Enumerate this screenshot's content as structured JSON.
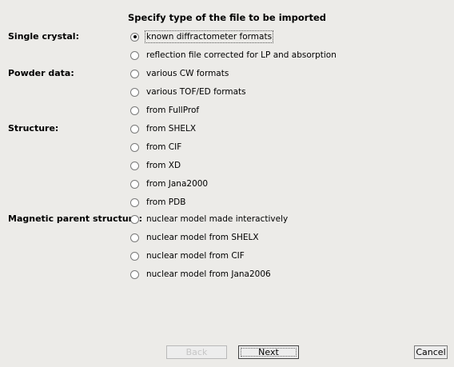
{
  "title": "Specify type of the file to be imported",
  "groups": [
    {
      "label": "Single crystal:",
      "options": [
        {
          "label": "known diffractometer formats",
          "checked": true
        },
        {
          "label": "reflection file corrected for LP and absorption",
          "checked": false
        }
      ]
    },
    {
      "label": "Powder data:",
      "options": [
        {
          "label": "various CW formats",
          "checked": false
        },
        {
          "label": "various TOF/ED formats",
          "checked": false
        },
        {
          "label": "from FullProf",
          "checked": false
        }
      ]
    },
    {
      "label": "Structure:",
      "options": [
        {
          "label": "from SHELX",
          "checked": false
        },
        {
          "label": "from CIF",
          "checked": false
        },
        {
          "label": "from XD",
          "checked": false
        },
        {
          "label": "from Jana2000",
          "checked": false
        },
        {
          "label": "from PDB",
          "checked": false
        }
      ]
    },
    {
      "label": "Magnetic parent structure:",
      "options": [
        {
          "label": "nuclear model made interactively",
          "checked": false
        },
        {
          "label": "nuclear model from SHELX",
          "checked": false
        },
        {
          "label": "nuclear model from CIF",
          "checked": false
        },
        {
          "label": "nuclear model from Jana2006",
          "checked": false
        }
      ]
    }
  ],
  "buttons": {
    "back": "Back",
    "next": "Next",
    "cancel": "Cancel"
  }
}
